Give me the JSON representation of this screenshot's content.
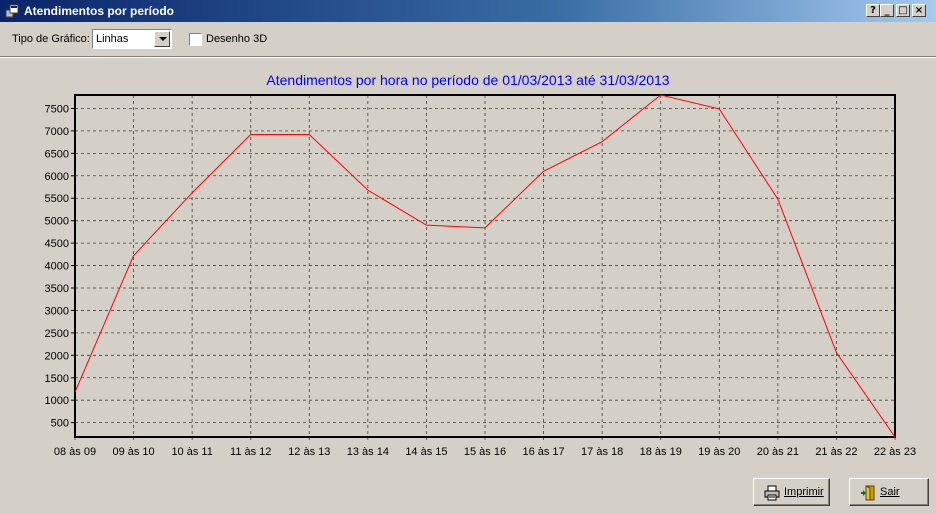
{
  "window": {
    "title": "Atendimentos por período",
    "controls": [
      "?",
      "_",
      "□",
      "×"
    ]
  },
  "toolbar": {
    "chart_type_label": "Tipo de Gráfico:",
    "chart_type_value": "Linhas",
    "draw3d_label": "Desenho 3D",
    "draw3d_checked": false
  },
  "buttons": {
    "print_label": "Imprimir",
    "exit_label": "Sair"
  },
  "chart_data": {
    "type": "line",
    "title": "Atendimentos por hora no período de 01/03/2013 até 31/03/2013",
    "title_color": "#0000ff",
    "line_color": "#ff0000",
    "grid": true,
    "categories": [
      "08 às 09",
      "09 às 10",
      "10 às 11",
      "11 às 12",
      "12 às 13",
      "13 às 14",
      "14 às 15",
      "15 às 16",
      "16 às 17",
      "17 às 18",
      "18 às 19",
      "19 às 20",
      "20 às 21",
      "21 às 22",
      "22 às 23"
    ],
    "values": [
      1180,
      4220,
      5620,
      6920,
      6920,
      5680,
      4900,
      4840,
      6100,
      6760,
      7800,
      7490,
      5480,
      2060,
      180
    ],
    "yticks": [
      500,
      1000,
      1500,
      2000,
      2500,
      3000,
      3500,
      4000,
      4500,
      5000,
      5500,
      6000,
      6500,
      7000,
      7500
    ],
    "ylim": [
      180,
      7800
    ]
  }
}
